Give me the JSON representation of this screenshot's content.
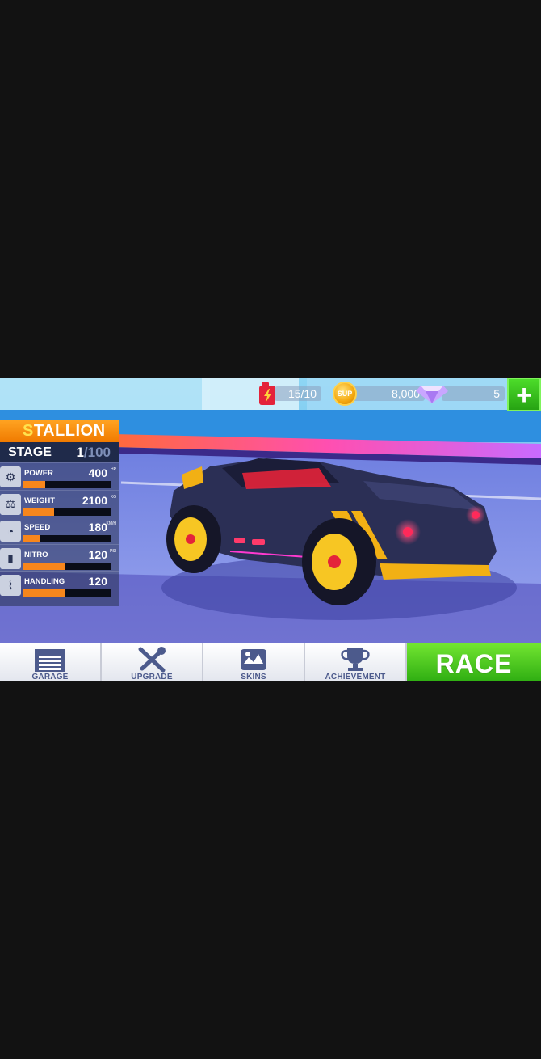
{
  "resources": {
    "fuel": "15/10",
    "coin_badge": "SUP",
    "coins": "8,000",
    "gems": "5",
    "plus_label": "+"
  },
  "car": {
    "name": "STALLION",
    "stage_label": "STAGE",
    "stage_current": "1",
    "stage_max": "/100"
  },
  "stats": [
    {
      "name": "POWER",
      "value": "400",
      "unit": "HP",
      "fill": 0.25,
      "icon": "engine-icon"
    },
    {
      "name": "WEIGHT",
      "value": "2100",
      "unit": "KG",
      "fill": 0.35,
      "icon": "weight-icon"
    },
    {
      "name": "SPEED",
      "value": "180",
      "unit": "KM/H",
      "fill": 0.18,
      "icon": "speedometer-icon"
    },
    {
      "name": "NITRO",
      "value": "120",
      "unit": "PSI",
      "fill": 0.47,
      "icon": "nitro-icon"
    },
    {
      "name": "HANDLING",
      "value": "120",
      "unit": "",
      "fill": 0.47,
      "icon": "suspension-icon"
    }
  ],
  "nav": {
    "garage": "GARAGE",
    "upgrade": "UPGRADE",
    "skins": "SKINS",
    "achievement": "ACHIEVEMENT",
    "race": "RACE"
  },
  "colors": {
    "accent_orange": "#f7861c",
    "race_green": "#4cc923",
    "nav_text": "#4c5a8c"
  }
}
